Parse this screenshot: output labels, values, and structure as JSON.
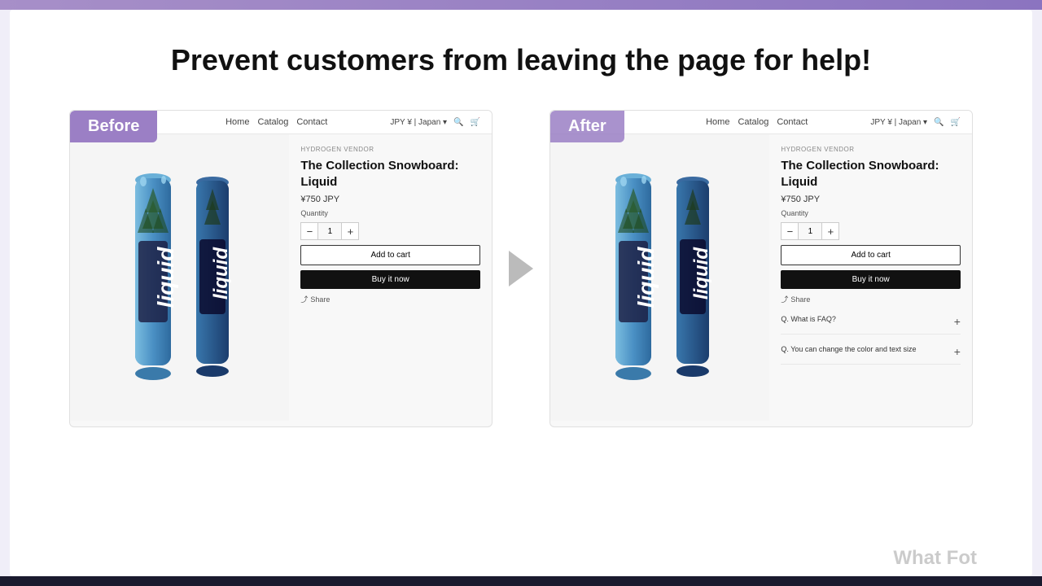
{
  "topBar": {
    "color": "#a78fc8"
  },
  "headline": "Prevent customers from leaving the page for help!",
  "before": {
    "label": "Before",
    "nav": {
      "links": [
        "Home",
        "Catalog",
        "Contact"
      ],
      "right": "JPY ¥ | Japan ▾"
    },
    "vendor": "HYDROGEN VENDOR",
    "title": "The Collection Snowboard: Liquid",
    "price": "¥750 JPY",
    "quantityLabel": "Quantity",
    "qty": "1",
    "addToCart": "Add to cart",
    "buyNow": "Buy it now",
    "share": "Share"
  },
  "after": {
    "label": "After",
    "nav": {
      "links": [
        "Home",
        "Catalog",
        "Contact"
      ],
      "right": "JPY ¥ | Japan ▾"
    },
    "vendor": "HYDROGEN VENDOR",
    "title": "The Collection Snowboard: Liquid",
    "price": "¥750 JPY",
    "quantityLabel": "Quantity",
    "qty": "1",
    "addToCart": "Add to cart",
    "buyNow": "Buy it now",
    "share": "Share",
    "faq": [
      {
        "q": "Q. What is FAQ?",
        "expanded": false
      },
      {
        "q": "Q. You can change the color and text size",
        "expanded": false
      }
    ]
  },
  "arrow": "▶",
  "bottomText": "What Fot"
}
